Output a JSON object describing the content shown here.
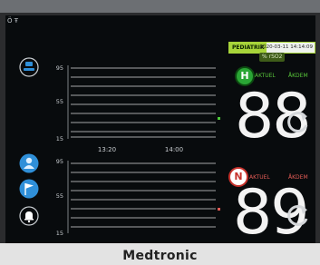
{
  "device": {
    "brand": "Medtronic"
  },
  "status": {
    "indicators": "Ö Ŧ"
  },
  "header": {
    "mode": "PEDIATRIK",
    "datetime": "2020-03-11 14:14:09",
    "sub_tag": "% rSO2"
  },
  "left_toolbar": {
    "items": [
      "profile",
      "patient",
      "flag",
      "alarm"
    ]
  },
  "trend_top": {
    "y_ticks": [
      "95",
      "55",
      "15"
    ],
    "x_ticks": [
      "13:20",
      "14:00"
    ]
  },
  "trend_bottom": {
    "y_ticks": [
      "95",
      "55",
      "15"
    ]
  },
  "channel_h": {
    "icon_letter": "H",
    "label_left": "AKTUEL",
    "label_right": "ÅKDEM",
    "value": "88"
  },
  "channel_n": {
    "icon_letter": "N",
    "label_left": "AKTUEL",
    "label_right": "ÅKDEM",
    "value": "89"
  },
  "colors": {
    "accent_green": "#a7d43a",
    "alarm_red": "#c6322c",
    "icon_blue": "#2f8fd8"
  }
}
